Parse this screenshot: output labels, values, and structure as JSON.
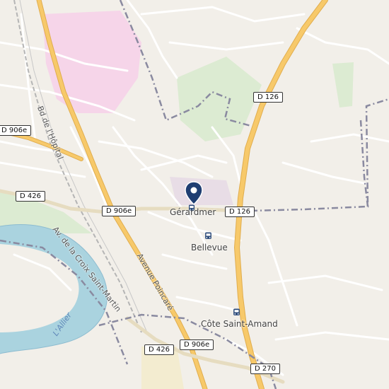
{
  "map": {
    "places": {
      "gerardmer": "Gérardmer",
      "bellevue": "Bellevue",
      "cote_saint_amand": "Côte Saint-Amand"
    },
    "roads": {
      "d126_top": "D 126",
      "d126_mid": "D 126",
      "d906e_left": "D 906e",
      "d906e_mid": "D 906e",
      "d906e_bottom": "D 906e",
      "d426_left": "D 426",
      "d426_bottom": "D 426",
      "d270": "D 270"
    },
    "streets": {
      "bd_hopital": "Bd de l'Hôpital",
      "av_croix_saint_martin": "Av. de la Croix Saint-Martin",
      "avenue_poincare": "Avenue Poincaré"
    },
    "river": "L'Allier",
    "icons": [
      "location-pin-icon",
      "bus-stop-icon",
      "bus-stop-icon",
      "bus-stop-icon"
    ],
    "colors": {
      "background": "#f2efe9",
      "water": "#aad3df",
      "major_road": "#f7c96a",
      "hospital_area": "#f6d5e9",
      "park": "#dcebd2",
      "boundary": "#8a8aa0",
      "pin": "#1f3e72"
    }
  }
}
